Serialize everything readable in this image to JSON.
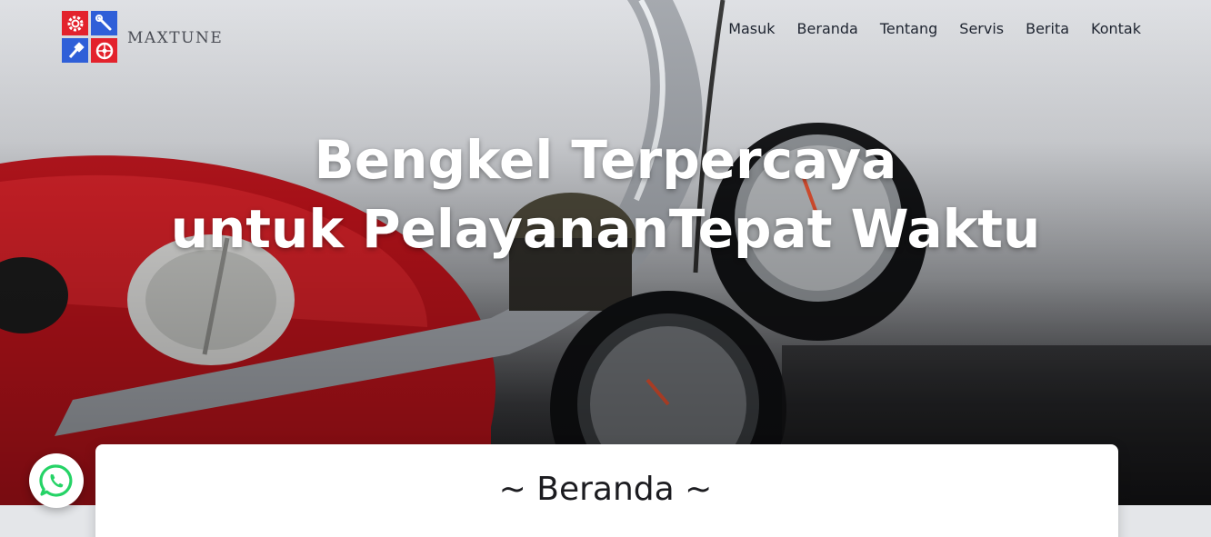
{
  "brand": {
    "name": "MAXTUNE",
    "logo_icons": [
      "gear-icon",
      "wrench-icon",
      "piston-icon",
      "wheel-icon"
    ]
  },
  "nav": {
    "items": [
      "Masuk",
      "Beranda",
      "Tentang",
      "Servis",
      "Berita",
      "Kontak"
    ]
  },
  "hero": {
    "line1_regular": "Bengkel ",
    "line1_bold": "Terpercaya",
    "line2_regular": "untuk Pelayanan",
    "line2_bold": "Tepat Waktu"
  },
  "section": {
    "title": "~ Beranda ~"
  },
  "floating": {
    "icon": "whatsapp-icon"
  },
  "colors": {
    "logo_red": "#e3222c",
    "logo_blue": "#2f5fd8",
    "whatsapp_green": "#25d366"
  }
}
